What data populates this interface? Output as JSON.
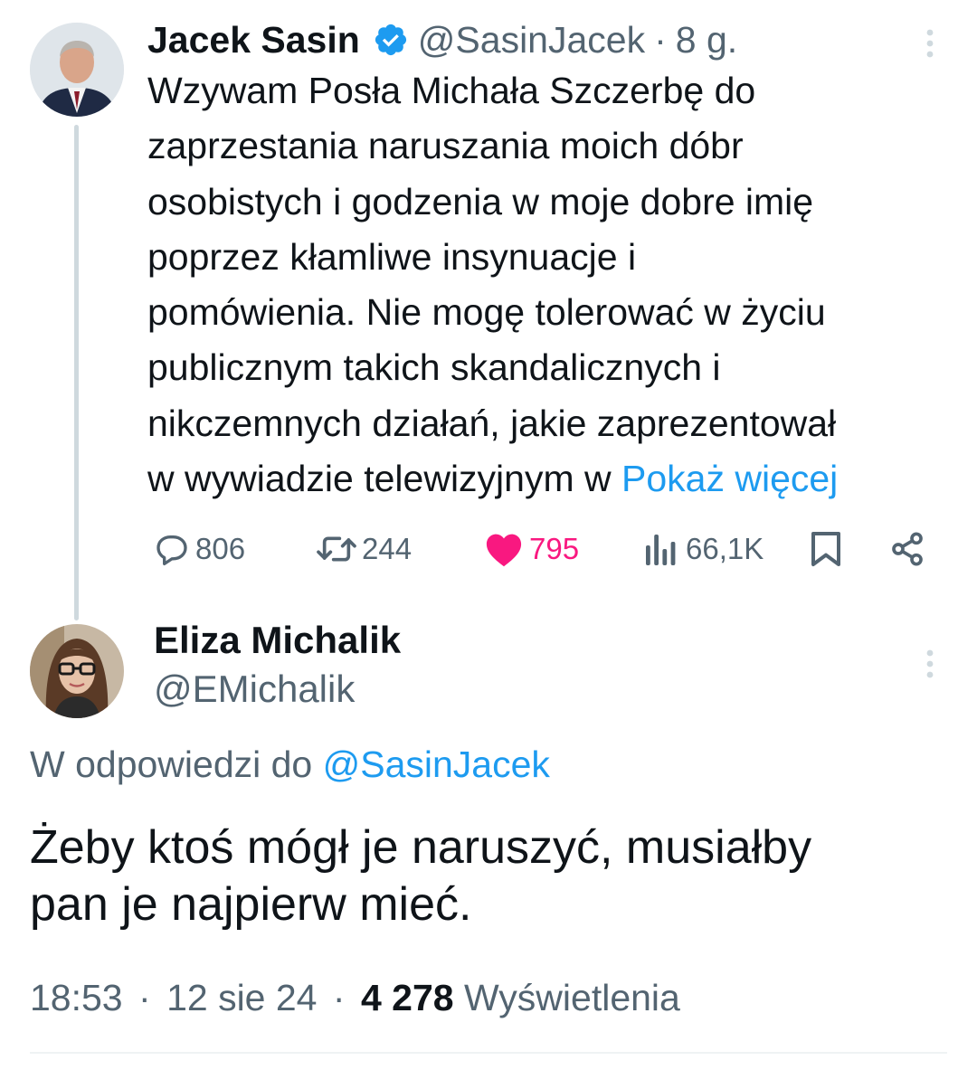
{
  "tweet": {
    "author": {
      "name": "Jacek Sasin",
      "handle": "@SasinJacek",
      "verified_color": "#1d9bf0"
    },
    "separator": "·",
    "time_ago": "8 g.",
    "text_lines": [
      "Wzywam Posła Michała Szczerbę do",
      "zaprzestania naruszania moich dóbr",
      "osobistych i godzenia w moje dobre imię",
      "poprzez kłamliwe insynuacje i",
      "pomówienia. Nie mogę tolerować w życiu",
      "publicznym takich skandalicznych i",
      "nikczemnych działań, jakie zaprezentował"
    ],
    "last_line_prefix": "w wywiadzie telewizyjnym w ",
    "show_more": "Pokaż więcej",
    "actions": {
      "replies": "806",
      "retweets": "244",
      "likes": "795",
      "views": "66,1K"
    },
    "icons": {
      "reply": "reply-icon",
      "retweet": "retweet-icon",
      "like": "heart-icon",
      "views": "views-icon",
      "bookmark": "bookmark-icon",
      "share": "share-icon",
      "more": "more-vertical-icon"
    },
    "like_color": "#f91880"
  },
  "reply": {
    "author": {
      "name": "Eliza Michalik",
      "handle": "@EMichalik"
    },
    "replying_to_prefix": "W odpowiedzi do ",
    "replying_to_handle": "@SasinJacek",
    "text_lines": [
      "Żeby ktoś mógł je naruszyć, musiałby",
      "pan je najpierw mieć."
    ],
    "time": "18:53",
    "separator": "·",
    "date": "12 sie 24",
    "views_count": "4 278",
    "views_label": "Wyświetlenia"
  },
  "colors": {
    "link": "#1d9bf0",
    "muted": "#536471",
    "thread_line": "#cfd9de"
  }
}
